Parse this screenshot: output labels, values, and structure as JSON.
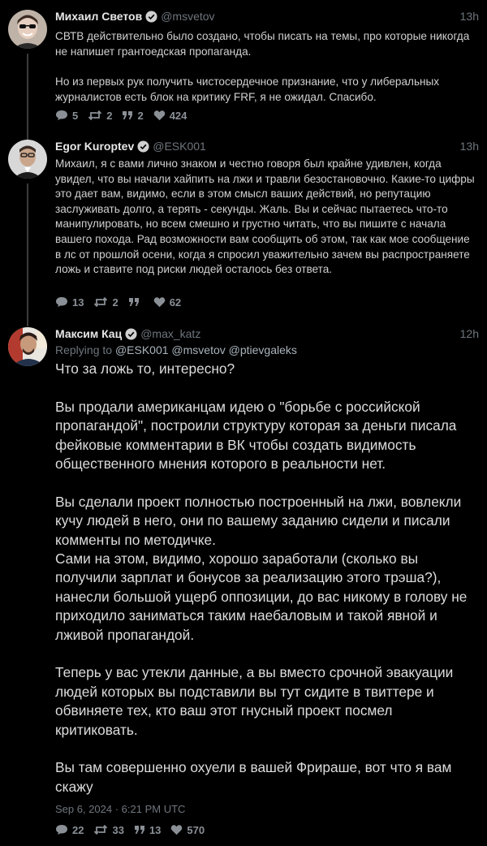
{
  "tweets": [
    {
      "name": "Михаил Светов",
      "handle": "@msvetov",
      "time": "13h",
      "paragraphs": [
        "СВТВ действительно было создано, чтобы писать на темы, про которые никогда не напишет грантоедская пропаганда.",
        "Но из первых рук получить чистосердечное признание, что у либеральных журналистов есть блок на критику FRF, я не ожидал. Спасибо."
      ],
      "stats": {
        "replies": "5",
        "retweets": "2",
        "quotes": "2",
        "likes": "424"
      }
    },
    {
      "name": "Egor Kuroptev",
      "handle": "@ESK001",
      "time": "13h",
      "paragraphs": [
        "Михаил, я с вами лично знаком и честно говоря был крайне удивлен, когда увидел, что вы начали хайпить на лжи и травли безостановочно. Какие-то цифры это дает вам, видимо, если в этом смысл ваших действий, но репутацию заслуживать долго, а терять - секунды. Жаль. Вы и сейчас пытаетесь что-то манипулировать, но всем смешно и грустно читать, что вы пишите с начала вашего похода. Рад возможности вам сообщить об этом, так как мое сообщение в лс от прошлой осени, когда я спросил уважительно зачем вы распространяете ложь и ставите под риски людей осталось без ответа."
      ],
      "stats": {
        "replies": "13",
        "retweets": "2",
        "quotes": "",
        "likes": "62"
      }
    },
    {
      "name": "Максим Кац",
      "handle": "@max_katz",
      "time": "12h",
      "replying_label": "Replying to",
      "replying_to": "@ESK001 @msvetov @ptievgaleks",
      "paragraphs": [
        "Что за ложь то, интересно?",
        "Вы продали американцам идею о \"борьбе с российской пропагандой\", построили структуру которая за деньги писала фейковые комментарии в ВК чтобы создать видимость общественного мнения которого в реальности нет.",
        "Вы сделали проект полностью построенный на лжи, вовлекли кучу людей в него, они по вашему заданию сидели и писали комменты по методичке.\nСами на этом, видимо, хорошо заработали (сколько вы получили зарплат и бонусов за реализацию этого трэша?), нанесли большой ущерб оппозиции, до вас никому в голову не приходило заниматься таким наебаловым и такой явной и лживой пропагандой.",
        "Теперь у вас утекли данные, а вы вместо срочной эвакуации людей которых вы подставили вы тут сидите в твиттере и обвиняете тех, кто ваш этот гнусный проект посмел критиковать.",
        "Вы там совершенно охуели в вашей Фрираше, вот что я вам скажу"
      ],
      "timestamp": "Sep 6, 2024 · 6:21 PM UTC",
      "stats": {
        "replies": "22",
        "retweets": "33",
        "quotes": "13",
        "likes": "570"
      }
    }
  ],
  "icons": {
    "reply": "comment-icon",
    "retweet": "retweet-icon",
    "quote": "quote-icon",
    "like": "heart-icon",
    "verified": "verified-badge-icon"
  },
  "colors": {
    "background": "#000000",
    "text": "#d9d9d9",
    "muted": "#6e767d",
    "thread_line": "#3a3a3a"
  }
}
